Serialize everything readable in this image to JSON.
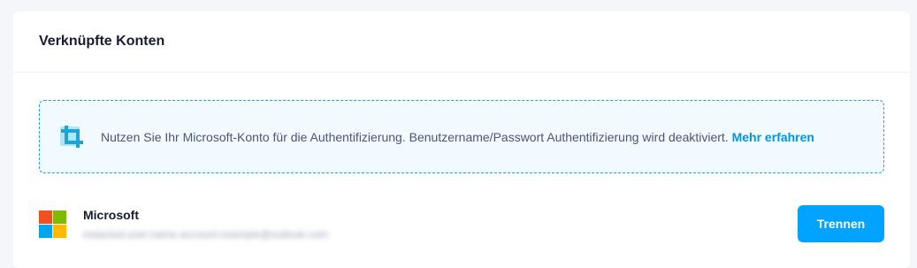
{
  "card": {
    "title": "Verknüpfte Konten"
  },
  "notice": {
    "icon": "crop-icon",
    "text": "Nutzen Sie Ihr Microsoft-Konto für die Authentifizierung. Benutzername/Passwort Authentifizierung wird deaktiviert. ",
    "link_label": "Mehr erfahren"
  },
  "account": {
    "provider_icon": "microsoft-logo",
    "name": "Microsoft",
    "email": "redacted.user.name.account.example@outlook.com",
    "disconnect_label": "Trennen"
  },
  "colors": {
    "accent": "#00a3ff",
    "link": "#0095e8",
    "notice_border": "#1ba7d6",
    "notice_bg": "#f1fafe",
    "ms_red": "#f25022",
    "ms_green": "#7fba00",
    "ms_blue": "#00a4ef",
    "ms_yellow": "#ffb900"
  }
}
